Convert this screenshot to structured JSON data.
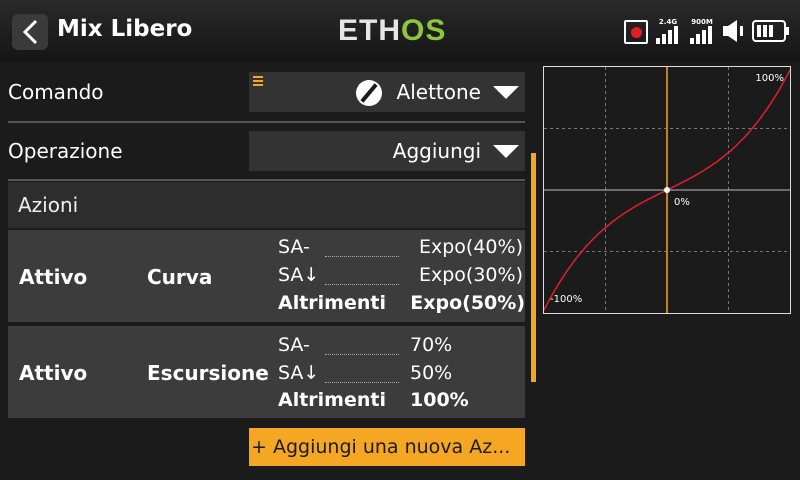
{
  "header": {
    "title": "Mix Libero",
    "logo_main": "ETH",
    "logo_accent": "OS",
    "signal1_label": "2.4G",
    "signal2_label": "900M"
  },
  "form": {
    "comando_label": "Comando",
    "comando_value": "Alettone",
    "operazione_label": "Operazione",
    "operazione_value": "Aggiungi"
  },
  "azioni": {
    "title": "Azioni",
    "items": [
      {
        "state": "Attivo",
        "kind": "Curva",
        "conditions": [
          {
            "switch": "SA-",
            "value": "Expo(40%)"
          },
          {
            "switch": "SA↓",
            "value": "Expo(30%)"
          },
          {
            "switch": "Altrimenti",
            "value": "Expo(50%)"
          }
        ]
      },
      {
        "state": "Attivo",
        "kind": "Escursione",
        "conditions": [
          {
            "switch": "SA-",
            "value": "70%"
          },
          {
            "switch": "SA↓",
            "value": "50%"
          },
          {
            "switch": "Altrimenti",
            "value": "100%"
          }
        ]
      }
    ],
    "add_label": "+ Aggiungi una nuova Az..."
  },
  "graph": {
    "label_max": "100%",
    "label_mid": "0%",
    "label_min": "-100%",
    "curve_color": "#e0202a",
    "axis_color": "#f5a623"
  },
  "colors": {
    "accent": "#f5a623",
    "logo_green": "#8cc63f",
    "record": "#e51c23"
  }
}
